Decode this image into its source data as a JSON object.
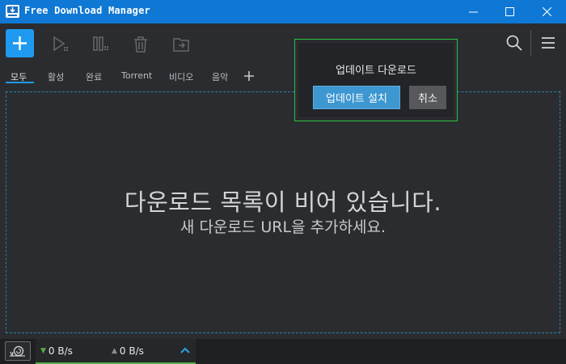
{
  "window": {
    "title": "Free Download Manager",
    "accent_color": "#0f78d4",
    "controls": {
      "minimize_icon": "minimize-icon",
      "maximize_icon": "maximize-icon",
      "close_icon": "close-icon"
    }
  },
  "toolbar": {
    "add_icon": "plus-icon",
    "buttons": [
      "play-icon",
      "pause-icon",
      "trash-icon",
      "move-icon"
    ],
    "search_icon": "search-icon",
    "menu_icon": "hamburger-icon"
  },
  "tabs": [
    {
      "label": "모두",
      "active": true
    },
    {
      "label": "활성",
      "active": false
    },
    {
      "label": "완료",
      "active": false
    },
    {
      "label": "Torrent",
      "active": false
    },
    {
      "label": "비디오",
      "active": false
    },
    {
      "label": "음악",
      "active": false
    }
  ],
  "empty_state": {
    "title": "다운로드 목록이 비어 있습니다.",
    "subtitle": "새 다운로드 URL을 추가하세요."
  },
  "update_popup": {
    "title": "업데이트 다운로드",
    "install_label": "업데이트 설치",
    "cancel_label": "취소"
  },
  "status": {
    "download_speed": "0 B/s",
    "upload_speed": "0 B/s",
    "speed_mode_icon": "snail-icon",
    "expand_icon": "chevron-up-icon"
  }
}
